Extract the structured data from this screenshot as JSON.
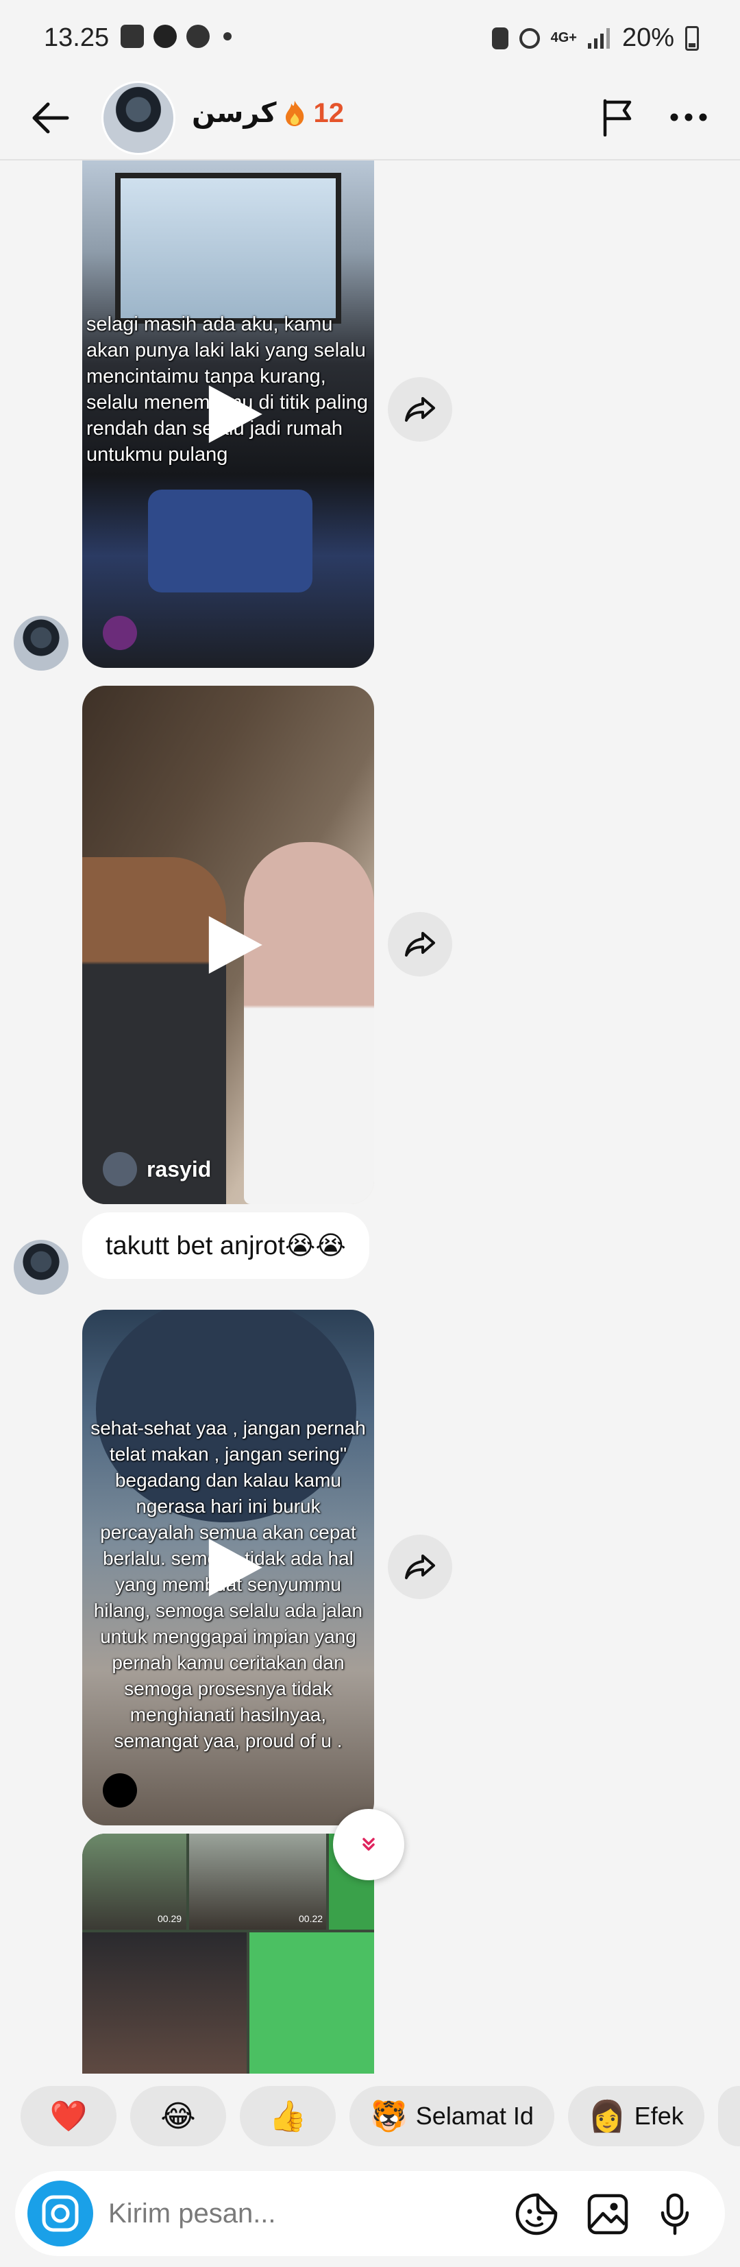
{
  "status_bar": {
    "time": "13.25",
    "battery": "20%",
    "network": "4G+"
  },
  "header": {
    "contact_name": "كرسن",
    "streak_icon": "fire-icon",
    "streak_count": "12"
  },
  "messages": [
    {
      "type": "video",
      "overlay_text": "selagi masih ada aku, kamu akan punya laki laki yang selalu mencintaimu tanpa kurang, selalu menemuimu di titik paling rendah dan selalu jadi rumah untukmu pulang"
    },
    {
      "type": "video",
      "author": "rasyid"
    },
    {
      "type": "text",
      "text": "takutt bet anjrot😭😭"
    },
    {
      "type": "video",
      "overlay_text": "sehat-sehat yaa , jangan pernah telat makan , jangan sering\" begadang dan kalau kamu ngerasa hari ini buruk percayalah semua akan cepat berlalu. semoga tidak ada hal yang membuat senyummu hilang, semoga selalu ada jalan untuk menggapai impian yang pernah kamu ceritakan dan semoga prosesnya tidak menghianati hasilnyaa, semangat yaa, proud of u ."
    },
    {
      "type": "video",
      "thumb_times": [
        "00.29",
        "00.22"
      ]
    }
  ],
  "quick_reactions": [
    {
      "emoji": "❤️"
    },
    {
      "emoji": "😂"
    },
    {
      "emoji": "👍"
    },
    {
      "emoji": "🐯",
      "label": "Selamat Id"
    },
    {
      "emoji": "👩",
      "label": "Efek"
    }
  ],
  "composer": {
    "placeholder": "Kirim pesan..."
  },
  "colors": {
    "accent": "#1aa0e8",
    "streak": "#e5542b",
    "scroll_arrow": "#e0245e"
  }
}
